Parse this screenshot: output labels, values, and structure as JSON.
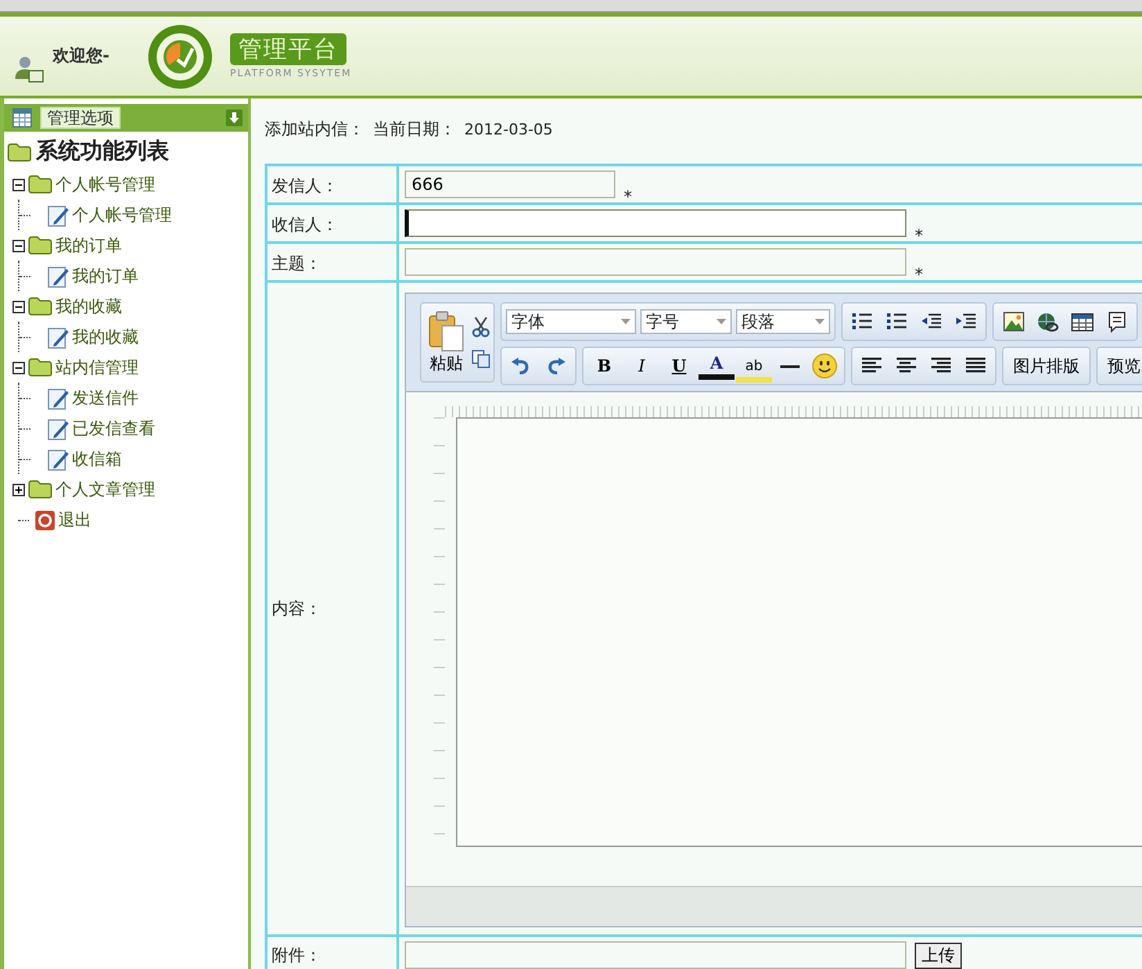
{
  "header": {
    "welcome": "欢迎您-",
    "logo_title": "管理平台",
    "logo_subtitle": "PLATFORM SYSYTEM"
  },
  "sidebar": {
    "options_button": "管理选项",
    "title": "系统功能列表",
    "tree": [
      {
        "kind": "folder",
        "label": "个人帐号管理",
        "expanded": true,
        "children": [
          {
            "kind": "page",
            "label": "个人帐号管理"
          }
        ]
      },
      {
        "kind": "folder",
        "label": "我的订单",
        "expanded": true,
        "children": [
          {
            "kind": "page",
            "label": "我的订单"
          }
        ]
      },
      {
        "kind": "folder",
        "label": "我的收藏",
        "expanded": true,
        "children": [
          {
            "kind": "page",
            "label": "我的收藏"
          }
        ]
      },
      {
        "kind": "folder",
        "label": "站内信管理",
        "expanded": true,
        "children": [
          {
            "kind": "page",
            "label": "发送信件"
          },
          {
            "kind": "page",
            "label": "已发信查看"
          },
          {
            "kind": "page",
            "label": "收信箱"
          }
        ]
      },
      {
        "kind": "folder",
        "label": "个人文章管理",
        "expanded": false
      },
      {
        "kind": "exit",
        "label": "退出"
      }
    ]
  },
  "page_heading": {
    "title": "添加站内信：",
    "date_label": "当前日期：",
    "date": "2012-03-05"
  },
  "form": {
    "fields": [
      {
        "kind": "short",
        "label": "发信人：",
        "value": "666",
        "focused": false,
        "required_mark": "*"
      },
      {
        "kind": "long",
        "label": "收信人：",
        "focused": true,
        "required_mark": "*"
      },
      {
        "kind": "long",
        "label": "主题：",
        "focused": false,
        "required_mark": "*"
      },
      {
        "kind": "editor",
        "label": "内容："
      },
      {
        "kind": "upload",
        "label": "附件：",
        "button": "上传"
      }
    ]
  },
  "editor": {
    "paste": "粘贴",
    "selects": [
      "字体",
      "字号",
      "段落"
    ],
    "row1": [
      [
        {
          "kind": "olist"
        },
        {
          "kind": "ulist"
        },
        {
          "kind": "outdent"
        },
        {
          "kind": "indent"
        }
      ],
      [
        {
          "kind": "image"
        },
        {
          "kind": "globe"
        },
        {
          "kind": "table"
        },
        {
          "kind": "note"
        }
      ]
    ],
    "row2": [
      [
        {
          "kind": "undo"
        },
        {
          "kind": "redo"
        }
      ],
      [
        {
          "kind": "bold",
          "label": "B"
        },
        {
          "kind": "italic",
          "label": "I"
        },
        {
          "kind": "underline",
          "label": "U"
        },
        {
          "kind": "color",
          "label": "A"
        },
        {
          "kind": "highlight",
          "label": "ab"
        },
        {
          "kind": "hr"
        },
        {
          "kind": "smiley"
        }
      ],
      [
        {
          "kind": "left"
        },
        {
          "kind": "center"
        },
        {
          "kind": "right"
        },
        {
          "kind": "justify"
        }
      ],
      [
        {
          "kind": "text",
          "label": "图片排版"
        }
      ],
      [
        {
          "kind": "text",
          "label": "预览"
        }
      ]
    ]
  }
}
